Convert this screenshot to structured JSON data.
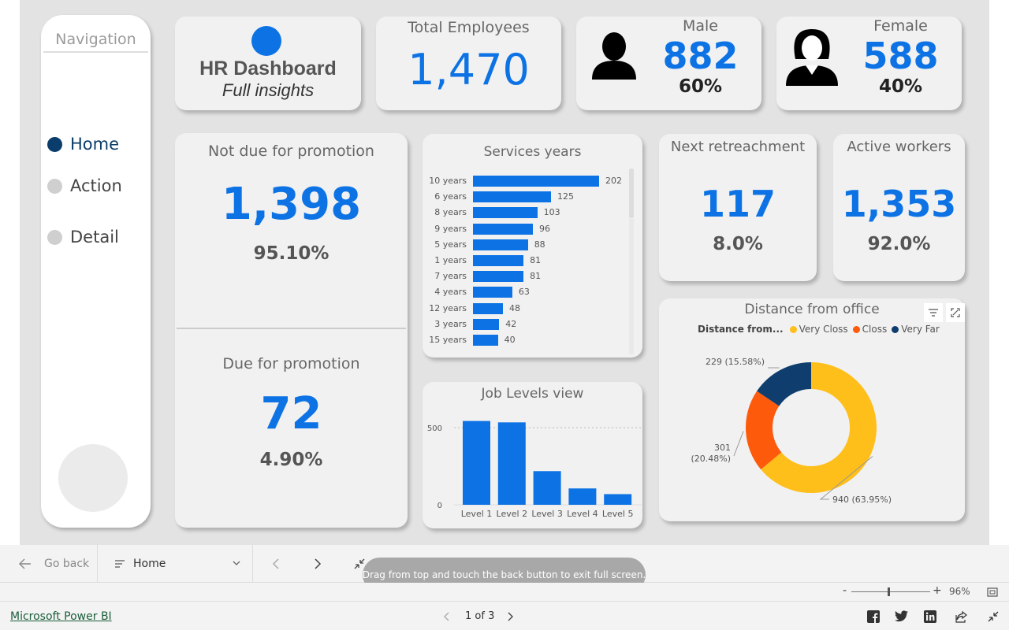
{
  "nav": {
    "title": "Navigation",
    "items": [
      {
        "label": "Home",
        "active": true
      },
      {
        "label": "Action",
        "active": false
      },
      {
        "label": "Detail",
        "active": false
      }
    ]
  },
  "logo_card": {
    "title": "HR Dashboard",
    "subtitle": "Full insights",
    "accent": "#0d73e5"
  },
  "total": {
    "title": "Total Employees",
    "value": "1,470"
  },
  "male": {
    "title": "Male",
    "value": "882",
    "pct": "60%"
  },
  "female": {
    "title": "Female",
    "value": "588",
    "pct": "40%"
  },
  "not_due": {
    "title": "Not due for promotion",
    "value": "1,398",
    "pct": "95.10%"
  },
  "due": {
    "title": "Due for promotion",
    "value": "72",
    "pct": "4.90%"
  },
  "retreach": {
    "title": "Next retreachment",
    "value": "117",
    "pct": "8.0%"
  },
  "active": {
    "title": "Active workers",
    "value": "1,353",
    "pct": "92.0%"
  },
  "service_title": "Services years",
  "job_title": "Job Levels view",
  "distance_title": "Distance from office",
  "controls": {
    "go_back": "Go back",
    "page_select": "Home",
    "toast": "Drag from top and touch the back button to exit full screen.",
    "zoom": "96%",
    "minus": "-",
    "plus": "+",
    "brand": "Microsoft Power BI",
    "pager": "1 of 3"
  },
  "colors": {
    "primary": "#0d73e5",
    "very_close": "#ffbf1a",
    "close": "#fd5a0b",
    "very_far": "#0f3e6e"
  },
  "chart_data": [
    {
      "type": "bar",
      "orientation": "horizontal",
      "title": "Services years",
      "categories": [
        "10 years",
        "6 years",
        "8 years",
        "9 years",
        "5 years",
        "1 years",
        "7 years",
        "4 years",
        "12 years",
        "3 years",
        "15 years"
      ],
      "values": [
        202,
        125,
        103,
        96,
        88,
        81,
        81,
        63,
        48,
        42,
        40
      ]
    },
    {
      "type": "bar",
      "title": "Job Levels view",
      "categories": [
        "Level 1",
        "Level 2",
        "Level 3",
        "Level 4",
        "Level 5"
      ],
      "values": [
        543,
        534,
        218,
        106,
        69
      ],
      "ylim": [
        0,
        500
      ],
      "yticks": [
        "0",
        "500"
      ]
    },
    {
      "type": "pie",
      "donut": true,
      "title": "Distance from office",
      "legend_title": "Distance from...",
      "categories": [
        "Very Closs",
        "Closs",
        "Very Far"
      ],
      "values": [
        940,
        301,
        229
      ],
      "labels": [
        "940 (63.95%)",
        "301 (20.48%)",
        "229 (15.58%)"
      ],
      "legend": "top"
    }
  ]
}
